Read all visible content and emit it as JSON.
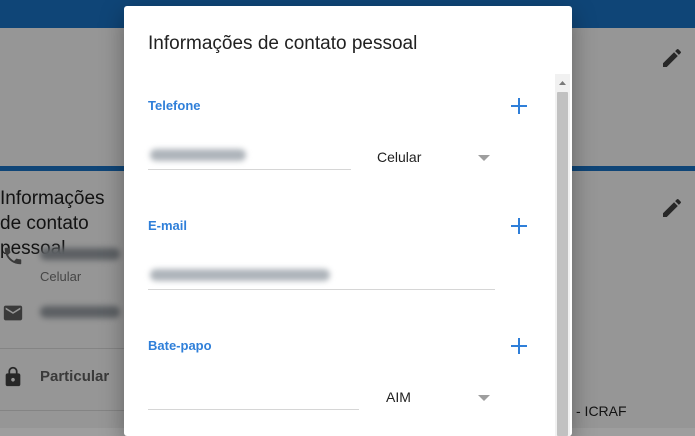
{
  "background": {
    "card_title": "Informações de contato pessoal",
    "phone_type": "Celular",
    "visibility": "Particular",
    "org_fragment": "- ICRAF"
  },
  "dialog": {
    "title": "Informações de contato pessoal",
    "phone": {
      "label": "Telefone",
      "type_selected": "Celular"
    },
    "email": {
      "label": "E-mail"
    },
    "chat": {
      "label": "Bate-papo",
      "service_selected": "AIM"
    }
  },
  "icons": {
    "add": "plus-icon",
    "edit": "pencil-icon",
    "phone": "phone-icon",
    "email": "envelope-icon",
    "privacy": "lock-icon",
    "dropdown": "caret-down-icon"
  },
  "colors": {
    "accent": "#2f7fd9",
    "topbar": "#1a73c6"
  }
}
